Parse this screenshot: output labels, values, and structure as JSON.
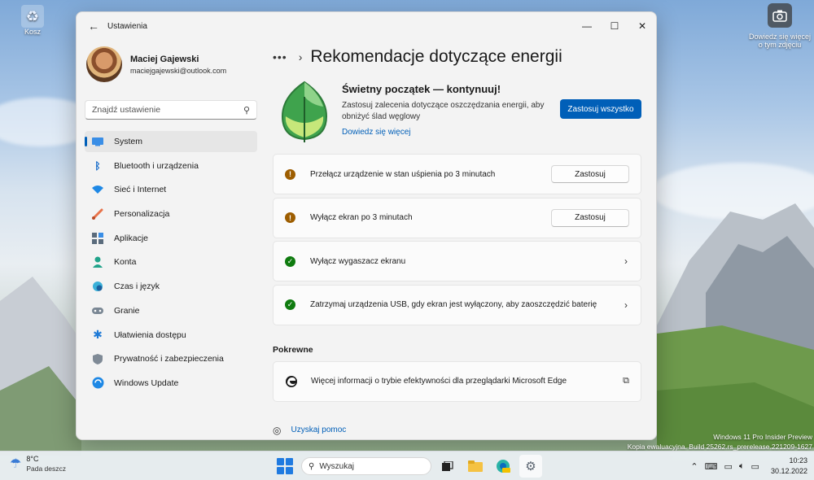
{
  "desktop": {
    "recycle_bin_label": "Kosz",
    "camera_widget_label_1": "Dowiedz się więcej",
    "camera_widget_label_2": "o tym zdjęciu"
  },
  "window": {
    "title": "Ustawienia",
    "controls": {
      "minimize": "—",
      "maximize": "☐",
      "close": "✕"
    }
  },
  "user": {
    "name": "Maciej Gajewski",
    "email": "maciejgajewski@outlook.com"
  },
  "search": {
    "placeholder": "Znajdź ustawienie"
  },
  "sidebar": {
    "items": [
      {
        "label": "System",
        "icon": "monitor-icon",
        "active": true
      },
      {
        "label": "Bluetooth i urządzenia",
        "icon": "bluetooth-icon"
      },
      {
        "label": "Sieć i Internet",
        "icon": "wifi-icon"
      },
      {
        "label": "Personalizacja",
        "icon": "brush-icon"
      },
      {
        "label": "Aplikacje",
        "icon": "apps-icon"
      },
      {
        "label": "Konta",
        "icon": "account-icon"
      },
      {
        "label": "Czas i język",
        "icon": "globe-clock-icon"
      },
      {
        "label": "Granie",
        "icon": "gamepad-icon"
      },
      {
        "label": "Ułatwienia dostępu",
        "icon": "accessibility-icon"
      },
      {
        "label": "Prywatność i zabezpieczenia",
        "icon": "shield-icon"
      },
      {
        "label": "Windows Update",
        "icon": "update-icon"
      }
    ]
  },
  "breadcrumb": {
    "more": "•••",
    "separator": "›"
  },
  "page": {
    "title": "Rekomendacje dotyczące energii"
  },
  "hero": {
    "title": "Świetny początek — kontynuuj!",
    "description": "Zastosuj zalecenia dotyczące oszczędzania energii, aby obniżyć ślad węglowy",
    "link": "Dowiedz się więcej",
    "apply_all": "Zastosuj wszystko"
  },
  "recommendations": [
    {
      "text": "Przełącz urządzenie w stan uśpienia po 3 minutach",
      "status": "warning",
      "action": "Zastosuj"
    },
    {
      "text": "Wyłącz ekran po 3 minutach",
      "status": "warning",
      "action": "Zastosuj"
    },
    {
      "text": "Wyłącz wygaszacz ekranu",
      "status": "ok",
      "action": "›"
    },
    {
      "text": "Zatrzymaj urządzenia USB, gdy ekran jest wyłączony, aby zaoszczędzić baterię",
      "status": "ok",
      "action": "›"
    }
  ],
  "related": {
    "title": "Pokrewne",
    "items": [
      {
        "text": "Więcej informacji o trybie efektywności dla przeglądarki Microsoft Edge",
        "icon": "edge-icon",
        "action_icon": "external-link-icon"
      }
    ]
  },
  "help": {
    "link": "Uzyskaj pomoc"
  },
  "watermark": {
    "line1": "Windows 11 Pro Insider Preview",
    "line2": "Kopia ewaluacyjna. Build 25262.rs_prerelease.221209-1627"
  },
  "taskbar": {
    "weather_temp": "8°C",
    "weather_condition": "Pada deszcz",
    "search_label": "Wyszukaj",
    "time": "10:23",
    "date": "30.12.2022",
    "accent_color": "#005fb8"
  }
}
